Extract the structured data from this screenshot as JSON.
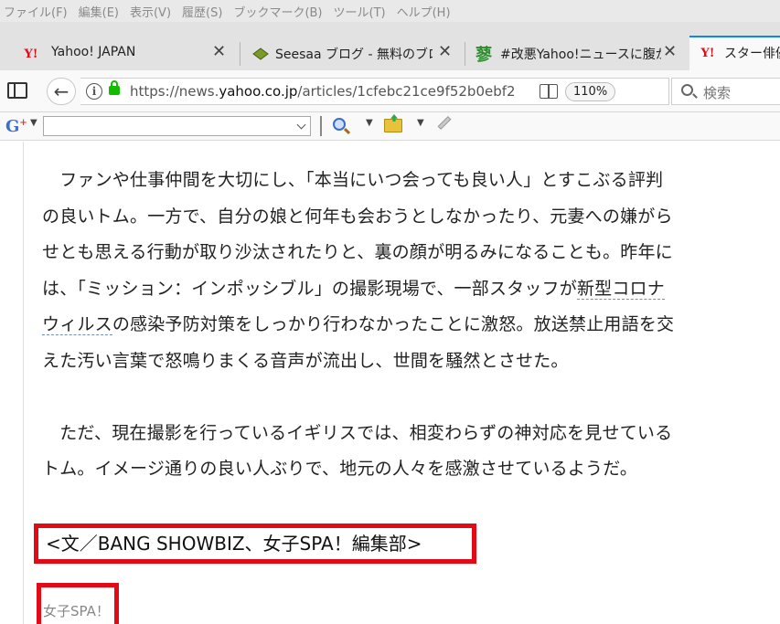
{
  "menu": [
    "ファイル(F)",
    "編集(E)",
    "表示(V)",
    "履歴(S)",
    "ブックマーク(B)",
    "ツール(T)",
    "ヘルプ(H)"
  ],
  "tabs": [
    {
      "label": "Yahoo! JAPAN",
      "favicon": "Y!",
      "favicon_color": "#e20a17"
    },
    {
      "label": "Seesaa ブログ - 無料のブログ",
      "favicon": "",
      "favicon_color": "#6b8e23"
    },
    {
      "label": "#改悪Yahoo!ニュースに腹が立",
      "favicon": "蓼",
      "favicon_color": "#2e8b2e"
    },
    {
      "label": "スター俳優",
      "favicon": "Y!",
      "favicon_color": "#e20a17"
    }
  ],
  "url": {
    "prefix": "https://news.",
    "host": "yahoo.co.jp",
    "path": "/articles/1cfebc21ce9f52b0ebf2"
  },
  "zoom": "110%",
  "search": {
    "placeholder": "検索"
  },
  "article": {
    "para1": [
      "　ファンや仕事仲間を大切にし、「本当にいつ会っても良い人」とすこぶる評判",
      "の良いトム。一方で、自分の娘と何年も会おうとしなかったり、元妻への嫌がら",
      "せとも思える行動が取り沙汰されたりと、裏の顔が明るみになることも。昨年に",
      "は、「ミッション：インポッシブル」の撮影現場で、一部スタッフが"
    ],
    "para1_link_a": "新型コロナ",
    "para1_link_b": "ウィルス",
    "para1_rest": "の感染予防対策をしっかり行わなかったことに激怒。放送禁止用語を交",
    "para1_last": "えた汚い言葉で怒鳴りまくる音声が流出し、世間を騒然とさせた。",
    "para2": [
      "　ただ、現在撮影を行っているイギリスでは、相変わらずの神対応を見せている",
      "トム。イメージ通りの良い人ぶりで、地元の人々を感激させているようだ。"
    ],
    "credit": "<文／BANG SHOWBIZ、女子SPA！編集部>",
    "source": "女子SPA！"
  },
  "colors": {
    "highlight": "#e20a17",
    "accent": "#0a84ff",
    "lock": "#12bc00"
  }
}
